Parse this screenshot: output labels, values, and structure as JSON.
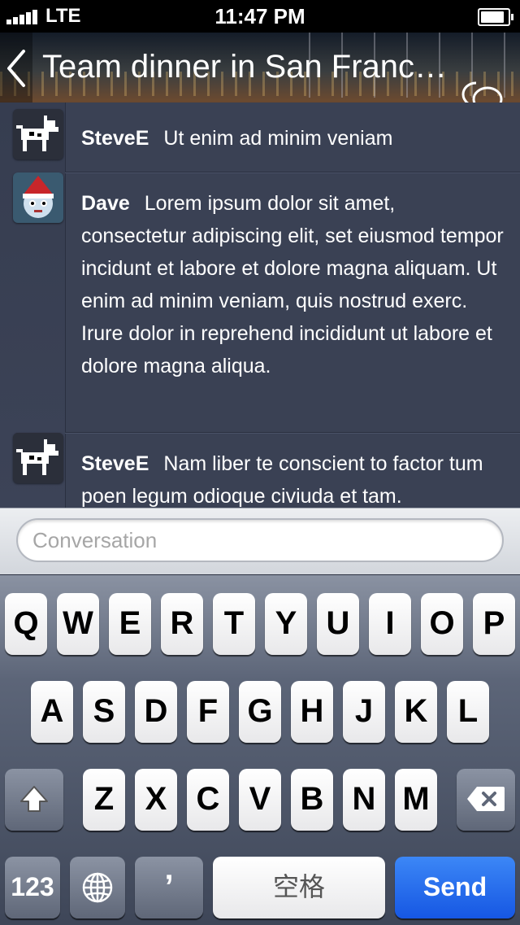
{
  "status_bar": {
    "carrier": "LTE",
    "time": "11:47 PM"
  },
  "header": {
    "title": "Team dinner in San Franc…",
    "back_icon": "chevron-left-icon",
    "chat_icon": "chat-bubbles-icon"
  },
  "messages": [
    {
      "author": "SteveE",
      "text": "Ut enim ad minim veniam",
      "avatar": "dog-avatar"
    },
    {
      "author": "Dave",
      "text": "Lorem ipsum dolor sit amet, consectetur adipiscing elit, set eiusmod tempor incidunt et labore et dolore magna aliquam. Ut enim ad minim veniam, quis nostrud exerc. Irure dolor in reprehend incididunt ut labore et dolore magna aliqua.",
      "avatar": "santa-hat-avatar"
    },
    {
      "author": "SteveE",
      "text": "Nam liber te conscient to factor tum poen legum odioque civiuda et tam.",
      "avatar": "dog-avatar"
    }
  ],
  "composer": {
    "placeholder": "Conversation",
    "value": ""
  },
  "keyboard": {
    "row1": [
      "Q",
      "W",
      "E",
      "R",
      "T",
      "Y",
      "U",
      "I",
      "O",
      "P"
    ],
    "row2": [
      "A",
      "S",
      "D",
      "F",
      "G",
      "H",
      "J",
      "K",
      "L"
    ],
    "row3": [
      "Z",
      "X",
      "C",
      "V",
      "B",
      "N",
      "M"
    ],
    "numbers_label": "123",
    "apostrophe_label": "’",
    "space_label": "空格",
    "send_label": "Send"
  },
  "colors": {
    "send_key": "#1f66ec",
    "message_bg": "#3a4154"
  }
}
